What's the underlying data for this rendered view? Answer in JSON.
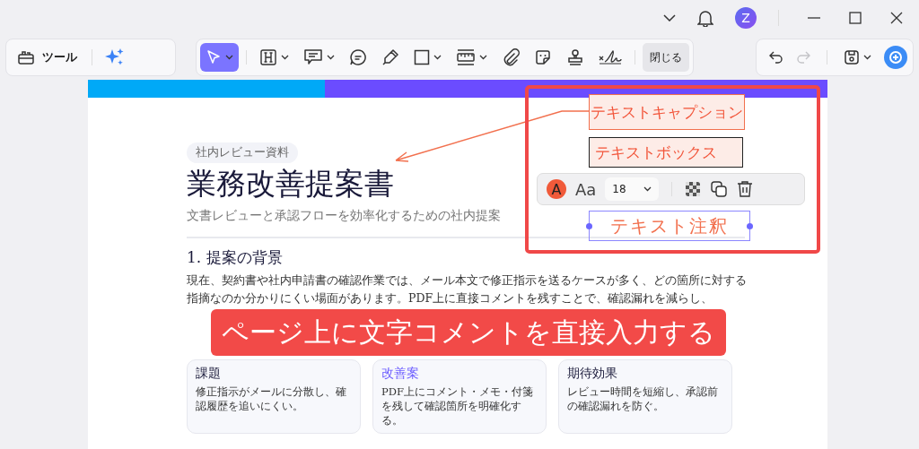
{
  "title_bar": {
    "avatar": "Z"
  },
  "toolbar": {
    "tools_label": "ツール",
    "tools": [
      {
        "kind": "cursor",
        "selected": true,
        "has_menu": true
      },
      {
        "kind": "heading",
        "selected": false,
        "has_menu": true
      },
      {
        "kind": "comment",
        "selected": false,
        "has_menu": true
      },
      {
        "kind": "bubble",
        "selected": false,
        "has_menu": false
      },
      {
        "kind": "pen",
        "selected": false,
        "has_menu": false
      },
      {
        "kind": "rect",
        "selected": false,
        "has_menu": true
      },
      {
        "kind": "ruler",
        "selected": false,
        "has_menu": true
      },
      {
        "kind": "clip",
        "selected": false,
        "has_menu": false
      },
      {
        "kind": "sticker",
        "selected": false,
        "has_menu": false
      },
      {
        "kind": "stamp",
        "selected": false,
        "has_menu": false
      },
      {
        "kind": "signature",
        "selected": false,
        "has_menu": false
      }
    ],
    "close_label": "閉じる",
    "redo_disabled": true
  },
  "document": {
    "badge": "社内レビュー資料",
    "title": "業務改善提案書",
    "subtitle": "文書レビューと承認フローを効率化するための社内提案",
    "section_heading": "1. 提案の背景",
    "paragraph": "現在、契約書や社内申請書の確認作業では、メール本文で修正指示を送るケースが多く、どの箇所に対する指摘なのか分かりにくい場面があります。PDF上に直接コメントを残すことで、確認漏れを減らし、",
    "cards": [
      {
        "heading": "課題",
        "highlighted": false,
        "text": "修正指示がメールに分散し、確認履歴を追いにくい。"
      },
      {
        "heading": "改善案",
        "highlighted": true,
        "text": "PDF上にコメント・メモ・付箋を残して確認箇所を明確化する。"
      },
      {
        "heading": "期待効果",
        "highlighted": false,
        "text": "レビュー時間を短縮し、承認前の確認漏れを防ぐ。"
      }
    ]
  },
  "annotations": {
    "caption": "テキストキャプション",
    "text_box": "テキストボックス",
    "text_note": "テキスト注釈",
    "format_bar": {
      "color_letter": "A",
      "font_label": "Aa",
      "font_size": "18"
    }
  },
  "banner": "ページ上に文字コメントを直接入力する"
}
